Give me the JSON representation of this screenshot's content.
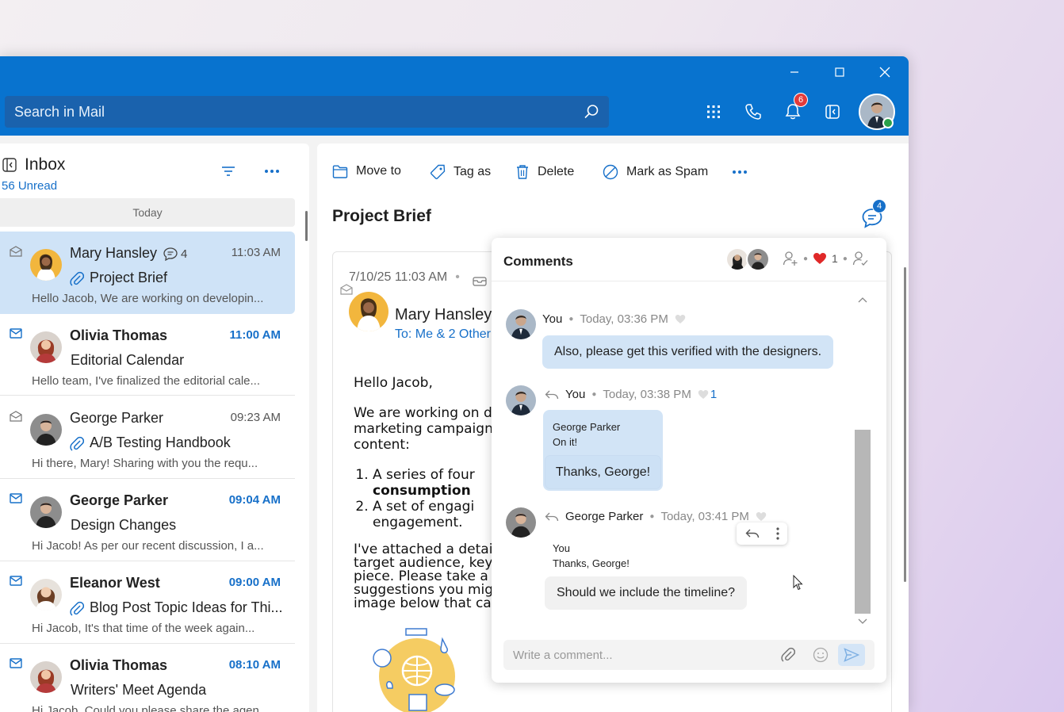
{
  "window": {
    "search_placeholder": "Search in Mail",
    "notifications_count": "6"
  },
  "inbox": {
    "title": "Inbox",
    "unread": "56 Unread",
    "group_label": "Today",
    "mails": [
      {
        "sender": "Mary Hansley",
        "comments": "4",
        "time": "11:03 AM",
        "subject": "Project Brief",
        "preview": "Hello Jacob, We are working on developin...",
        "unread": false,
        "attachment": true,
        "selected": true
      },
      {
        "sender": "Olivia Thomas",
        "time": "11:00 AM",
        "subject": "Editorial Calendar",
        "preview": "Hello team, I've finalized the editorial cale...",
        "unread": true,
        "attachment": false
      },
      {
        "sender": "George Parker",
        "time": "09:23 AM",
        "subject": "A/B Testing Handbook",
        "preview": "Hi there, Mary! Sharing with you the requ...",
        "unread": false,
        "attachment": true
      },
      {
        "sender": "George Parker",
        "time": "09:04 AM",
        "subject": "Design Changes",
        "preview": "Hi Jacob! As per our recent discussion, I a...",
        "unread": true,
        "attachment": false
      },
      {
        "sender": "Eleanor West",
        "time": "09:00 AM",
        "subject": "Blog Post Topic Ideas for Thi...",
        "preview": "Hi Jacob, It's that time of the week again...",
        "unread": true,
        "attachment": true
      },
      {
        "sender": "Olivia Thomas",
        "time": "08:10 AM",
        "subject": "Writers' Meet Agenda",
        "preview": "Hi Jacob, Could you please share the agen...",
        "unread": true,
        "attachment": false
      }
    ]
  },
  "toolbar": {
    "move_to": "Move to",
    "tag_as": "Tag as",
    "delete": "Delete",
    "mark_spam": "Mark as Spam"
  },
  "message": {
    "subject": "Project Brief",
    "comments_badge": "4",
    "date": "7/10/25 11:03 AM",
    "from": "Mary Hansley",
    "to": "To: Me & 2 Other",
    "body": {
      "greeting": "Hello Jacob,",
      "p1": [
        "We are working on d",
        "marketing campaign",
        "content:"
      ],
      "li1": [
        "A series of four",
        "consumption"
      ],
      "li2": [
        "A set of engagi",
        "engagement."
      ],
      "p2": [
        "I've attached a detai",
        "target audience, key",
        "piece. Please take a",
        "suggestions you mig",
        "image below that ca"
      ]
    }
  },
  "comments": {
    "title": "Comments",
    "likes": "1",
    "items": [
      {
        "author": "You",
        "time": "Today, 03:36 PM",
        "text": "Also, please get this verified with the designers."
      },
      {
        "author": "You",
        "time": "Today, 03:38 PM",
        "likes": "1",
        "quote_author": "George Parker",
        "quote_text": "On it!",
        "text": "Thanks, George!"
      },
      {
        "author": "George Parker",
        "time": "Today, 03:41 PM",
        "quote_author": "You",
        "quote_text": "Thanks, George!",
        "text": "Should we include the timeline?"
      }
    ],
    "composer_placeholder": "Write a comment..."
  }
}
